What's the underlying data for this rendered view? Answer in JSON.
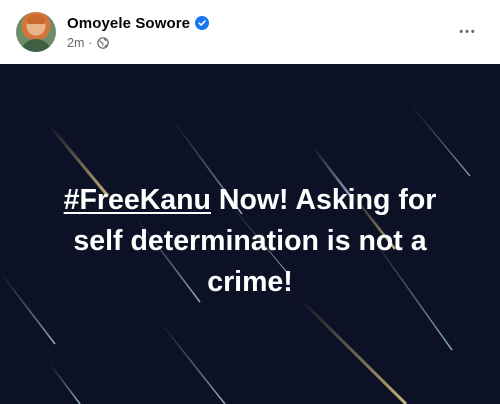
{
  "post": {
    "author": "Omoyele Sowore",
    "time": "2m",
    "separator": "·",
    "more_label": "•••"
  },
  "content": {
    "hashtag": "#FreeKanu",
    "text_rest": " Now! Asking for self determination is not a crime!"
  },
  "colors": {
    "verified": "#1877f2",
    "background": "#0d1126",
    "meta_text": "#65676b"
  },
  "icons": {
    "verified": "verified-badge-icon",
    "audience": "globe-icon",
    "more": "more-options-icon"
  }
}
